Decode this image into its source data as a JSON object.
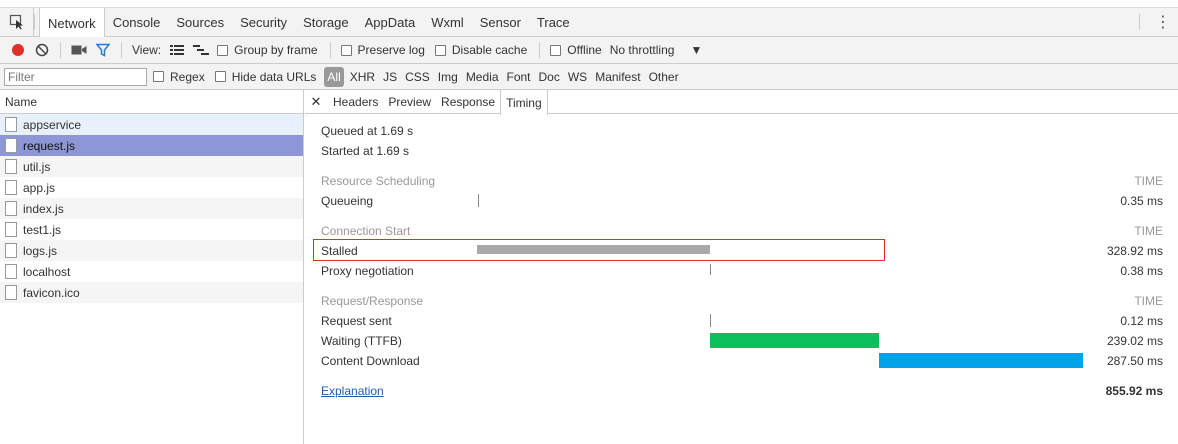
{
  "tabs": [
    "Network",
    "Console",
    "Sources",
    "Security",
    "Storage",
    "AppData",
    "Wxml",
    "Sensor",
    "Trace"
  ],
  "active_tab": "Network",
  "toolbar": {
    "view_label": "View:",
    "group_by_frame": "Group by frame",
    "preserve_log": "Preserve log",
    "disable_cache": "Disable cache",
    "offline": "Offline",
    "throttling": "No throttling",
    "record_color": "#e0302a",
    "filter_icon_color": "#2a7bd6"
  },
  "filterbar": {
    "placeholder": "Filter",
    "regex": "Regex",
    "hide_data_urls": "Hide data URLs",
    "types": [
      "All",
      "XHR",
      "JS",
      "CSS",
      "Img",
      "Media",
      "Font",
      "Doc",
      "WS",
      "Manifest",
      "Other"
    ],
    "selected_type": "All"
  },
  "requests": {
    "header": "Name",
    "items": [
      {
        "name": "appservice",
        "state": "hover"
      },
      {
        "name": "request.js",
        "state": "selected"
      },
      {
        "name": "util.js",
        "state": "odd"
      },
      {
        "name": "app.js",
        "state": "even"
      },
      {
        "name": "index.js",
        "state": "odd"
      },
      {
        "name": "test1.js",
        "state": "even"
      },
      {
        "name": "logs.js",
        "state": "odd"
      },
      {
        "name": "localhost",
        "state": "even"
      },
      {
        "name": "favicon.ico",
        "state": "odd"
      }
    ]
  },
  "detail": {
    "tabs": [
      "Headers",
      "Preview",
      "Response",
      "Timing"
    ],
    "active_tab": "Timing",
    "queued": "Queued at 1.69 s",
    "started": "Started at 1.69 s",
    "time_header": "TIME",
    "sections": [
      {
        "title": "Resource Scheduling",
        "rows": [
          {
            "label": "Queueing",
            "time": "0.35 ms"
          }
        ]
      },
      {
        "title": "Connection Start",
        "rows": [
          {
            "label": "Stalled",
            "time": "328.92 ms"
          },
          {
            "label": "Proxy negotiation",
            "time": "0.38 ms"
          }
        ]
      },
      {
        "title": "Request/Response",
        "rows": [
          {
            "label": "Request sent",
            "time": "0.12 ms"
          },
          {
            "label": "Waiting (TTFB)",
            "time": "239.02 ms"
          },
          {
            "label": "Content Download",
            "time": "287.50 ms"
          }
        ]
      }
    ],
    "explanation": "Explanation",
    "total": "855.92 ms",
    "colors": {
      "stalled_bar": "#a8a8a8",
      "ttfb_bar": "#0ac05a",
      "download_bar": "#04a3e8",
      "highlight_box": "#d9312a"
    }
  }
}
